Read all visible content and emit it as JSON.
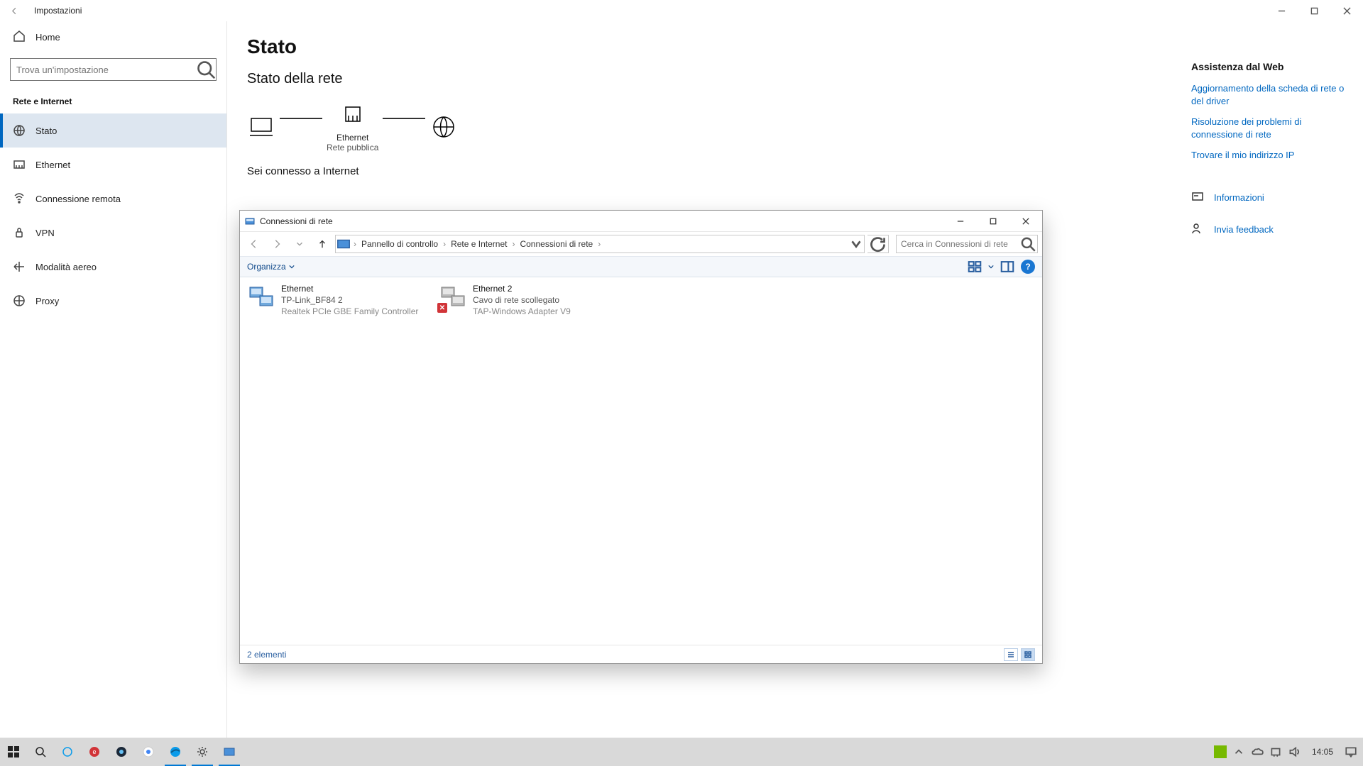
{
  "window": {
    "title": "Impostazioni"
  },
  "sidebar": {
    "home_label": "Home",
    "search_placeholder": "Trova un'impostazione",
    "section_title": "Rete e Internet",
    "items": [
      {
        "label": "Stato"
      },
      {
        "label": "Ethernet"
      },
      {
        "label": "Connessione remota"
      },
      {
        "label": "VPN"
      },
      {
        "label": "Modalità aereo"
      },
      {
        "label": "Proxy"
      }
    ]
  },
  "main": {
    "heading": "Stato",
    "subheading": "Stato della rete",
    "diagram": {
      "adapter_label": "Ethernet",
      "adapter_sub": "Rete pubblica"
    },
    "connected_text": "Sei connesso a Internet"
  },
  "rightpane": {
    "title": "Assistenza dal Web",
    "links": [
      "Aggiornamento della scheda di rete o del driver",
      "Risoluzione dei problemi di connessione di rete",
      "Trovare il mio indirizzo IP"
    ],
    "info_label": "Informazioni",
    "feedback_label": "Invia feedback"
  },
  "explorer": {
    "title": "Connessioni di rete",
    "breadcrumb": [
      "Pannello di controllo",
      "Rete e Internet",
      "Connessioni di rete"
    ],
    "search_placeholder": "Cerca in Connessioni di rete",
    "toolbar": {
      "organize": "Organizza"
    },
    "items": [
      {
        "name": "Ethernet",
        "sub1": "TP-Link_BF84 2",
        "sub2": "Realtek PCIe GBE Family Controller",
        "disconnected": false
      },
      {
        "name": "Ethernet 2",
        "sub1": "Cavo di rete scollegato",
        "sub2": "TAP-Windows Adapter V9",
        "disconnected": true
      }
    ],
    "status": "2 elementi"
  },
  "taskbar": {
    "clock": "14:05"
  }
}
